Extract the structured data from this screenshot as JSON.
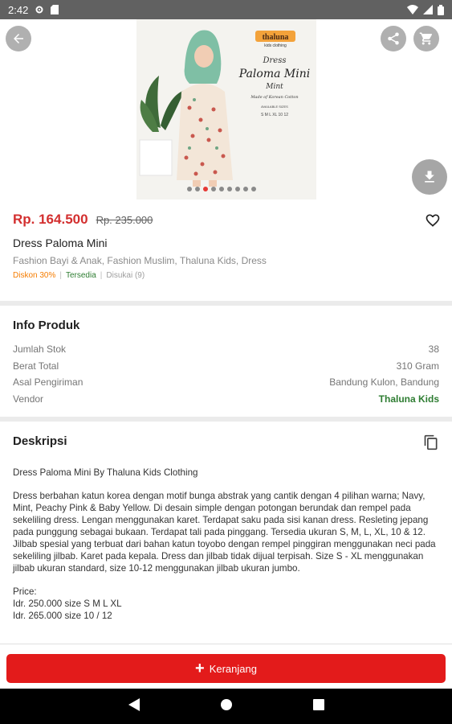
{
  "status_bar": {
    "time": "2:42"
  },
  "product": {
    "price": "Rp. 164.500",
    "old_price": "Rp. 235.000",
    "title": "Dress Paloma Mini",
    "categories": "Fashion Bayi & Anak, Fashion Muslim, Thaluna Kids, Dress",
    "badges": {
      "discount": "Diskon 30%",
      "availability": "Tersedia",
      "likes": "Disukai (9)"
    },
    "image": {
      "brand": "thaluna",
      "brand_sub": "kids clothing",
      "text_line1": "Dress",
      "text_line2": "Paloma Mini",
      "text_line3": "Mint",
      "text_line4": "Made of Korean Cotton",
      "text_line5": "AVAILABLE SIZES",
      "sizes": "S M L XL 10 12",
      "slide_count": 9,
      "active_slide": 2
    }
  },
  "info": {
    "title": "Info Produk",
    "rows": [
      {
        "label": "Jumlah Stok",
        "value": "38"
      },
      {
        "label": "Berat Total",
        "value": "310 Gram"
      },
      {
        "label": "Asal Pengiriman",
        "value": "Bandung Kulon, Bandung"
      },
      {
        "label": "Vendor",
        "value": "Thaluna Kids"
      }
    ]
  },
  "description": {
    "title": "Deskripsi",
    "heading": "Dress Paloma Mini By Thaluna Kids Clothing",
    "body": "Dress berbahan katun korea dengan motif bunga abstrak yang cantik dengan 4 pilihan warna; Navy, Mint, Peachy Pink & Baby Yellow. Di desain simple dengan potongan berundak dan rempel pada sekeliling dress. Lengan menggunakan karet. Terdapat saku pada sisi kanan dress. Resleting jepang pada punggung sebagai bukaan. Terdapat tali pada pinggang. Tersedia ukuran S, M, L, XL, 10 & 12. Jilbab spesial yang terbuat dari bahan katun toyobo dengan rempel pinggiran menggunakan neci pada sekeliling jilbab. Karet pada kepala. Dress dan jilbab tidak dijual terpisah. Size S - XL menggunakan jilbab ukuran standard, size 10-12 menggunakan jilbab ukuran jumbo.",
    "price_label": "Price:",
    "price_line1": "Idr. 250.000 size S M L XL",
    "price_line2": "Idr. 265.000 size 10 / 12"
  },
  "cart_button": {
    "label": "Keranjang"
  },
  "colors": {
    "accent": "#e31b1b",
    "price": "#d32f2f",
    "vendor": "#2e7d32",
    "discount": "#f57c00"
  }
}
